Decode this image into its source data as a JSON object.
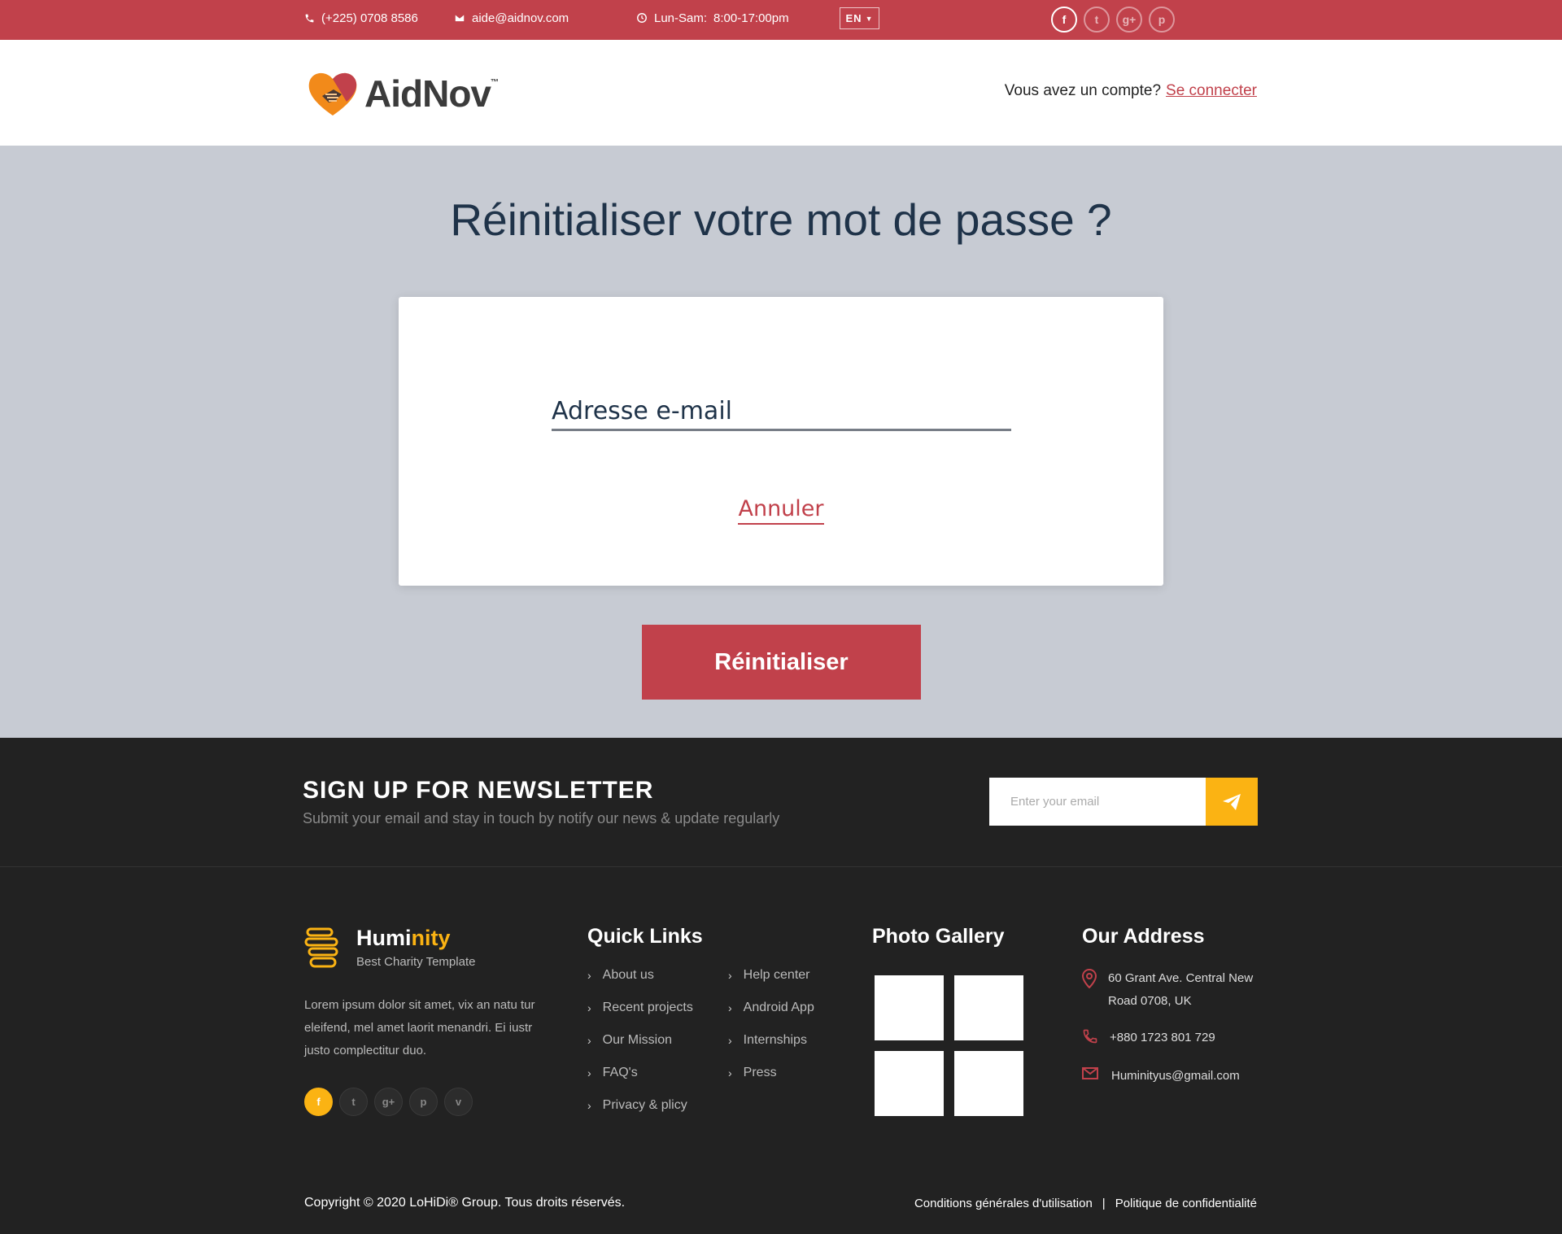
{
  "topbar": {
    "phone": "(+225) 0708 8586",
    "email": "aide@aidnov.com",
    "hours_label": "Lun-Sam:",
    "hours_value": "8:00-17:00pm",
    "language": "EN",
    "social": [
      {
        "icon": "facebook-icon",
        "glyph": "f"
      },
      {
        "icon": "twitter-icon",
        "glyph": "t"
      },
      {
        "icon": "google-plus-icon",
        "glyph": "g+"
      },
      {
        "icon": "pinterest-icon",
        "glyph": "p"
      }
    ]
  },
  "header": {
    "logo_text": "AidNov",
    "logo_tm": "™",
    "account_prompt": "Vous avez un compte?",
    "login_link": "Se connecter"
  },
  "main": {
    "title": "Réinitialiser votre mot de passe ?",
    "email_placeholder": "Adresse e-mail",
    "cancel_link": "Annuler",
    "reset_button": "Réinitialiser"
  },
  "newsletter": {
    "title": "SIGN UP FOR NEWSLETTER",
    "subtitle": "Submit your email and stay in touch by notify our news & update regularly",
    "input_placeholder": "Enter your email"
  },
  "footer": {
    "brand_name_a": "Humi",
    "brand_name_b": "nity",
    "brand_tagline": "Best Charity Template",
    "about": "Lorem ipsum dolor sit amet, vix an natu tur eleifend, mel amet laorit menandri. Ei iustr justo complectitur duo.",
    "social": [
      {
        "icon": "facebook-icon",
        "glyph": "f"
      },
      {
        "icon": "twitter-icon",
        "glyph": "t"
      },
      {
        "icon": "google-plus-icon",
        "glyph": "g+"
      },
      {
        "icon": "pinterest-icon",
        "glyph": "p"
      },
      {
        "icon": "vimeo-icon",
        "glyph": "v"
      }
    ],
    "quick_links_title": "Quick Links",
    "quick_links_col1": [
      "About us",
      "Recent projects",
      "Our Mission",
      "FAQ's",
      "Privacy & plicy"
    ],
    "quick_links_col2": [
      "Help center",
      "Android App",
      "Internships",
      "Press"
    ],
    "gallery_title": "Photo Gallery",
    "address_title": "Our Address",
    "address_line": "60 Grant Ave. Central New Road 0708, UK",
    "address_phone": "+880 1723 801 729",
    "address_email": "Huminityus@gmail.com",
    "copyright": "Copyright © 2020 LoHiDi® Group. Tous droits réservés.",
    "terms": "Conditions générales d'utilisation",
    "separator": "|",
    "privacy": "Politique de confidentialité"
  },
  "colors": {
    "brand_red": "#c1414b",
    "accent_yellow": "#fbb313",
    "footer_bg": "#222222",
    "main_bg": "#c7cbd3"
  }
}
